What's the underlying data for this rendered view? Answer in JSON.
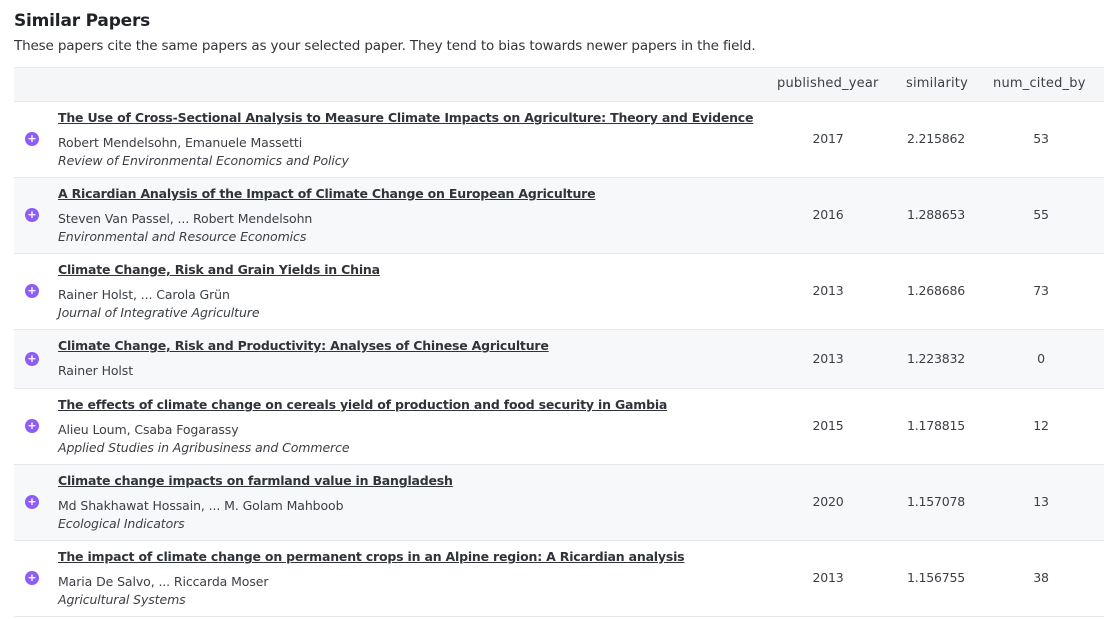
{
  "section": {
    "title": "Similar Papers",
    "subtitle": "These papers cite the same papers as your selected paper. They tend to bias towards newer papers in the field."
  },
  "table": {
    "columns": [
      "published_year",
      "similarity",
      "num_cited_by"
    ],
    "add_icon_glyph": "+",
    "rows": [
      {
        "title": "The Use of Cross-Sectional Analysis to Measure Climate Impacts on Agriculture: Theory and Evidence",
        "authors": "Robert Mendelsohn, Emanuele Massetti",
        "venue": "Review of Environmental Economics and Policy",
        "year": "2017",
        "similarity": "2.215862",
        "cited_by": "53"
      },
      {
        "title": "A Ricardian Analysis of the Impact of Climate Change on European Agriculture",
        "authors": "Steven Van Passel, ... Robert Mendelsohn",
        "venue": "Environmental and Resource Economics",
        "year": "2016",
        "similarity": "1.288653",
        "cited_by": "55"
      },
      {
        "title": "Climate Change, Risk and Grain Yields in China",
        "authors": "Rainer Holst, ... Carola Grün",
        "venue": "Journal of Integrative Agriculture",
        "year": "2013",
        "similarity": "1.268686",
        "cited_by": "73"
      },
      {
        "title": "Climate Change, Risk and Productivity: Analyses of Chinese Agriculture",
        "authors": "Rainer Holst",
        "venue": "",
        "year": "2013",
        "similarity": "1.223832",
        "cited_by": "0"
      },
      {
        "title": "The effects of climate change on cereals yield of production and food security in Gambia",
        "authors": "Alieu Loum, Csaba Fogarassy",
        "venue": "Applied Studies in Agribusiness and Commerce",
        "year": "2015",
        "similarity": "1.178815",
        "cited_by": "12"
      },
      {
        "title": "Climate change impacts on farmland value in Bangladesh",
        "authors": "Md Shakhawat Hossain, ... M. Golam Mahboob",
        "venue": "Ecological Indicators",
        "year": "2020",
        "similarity": "1.157078",
        "cited_by": "13"
      },
      {
        "title": "The impact of climate change on permanent crops in an Alpine region: A Ricardian analysis",
        "authors": "Maria De Salvo, ... Riccarda Moser",
        "venue": "Agricultural Systems",
        "year": "2013",
        "similarity": "1.156755",
        "cited_by": "38"
      }
    ]
  },
  "colors": {
    "accent": "#8e5cf7",
    "row_alt": "#f7f8fa",
    "header_bg": "#f5f6f8"
  }
}
